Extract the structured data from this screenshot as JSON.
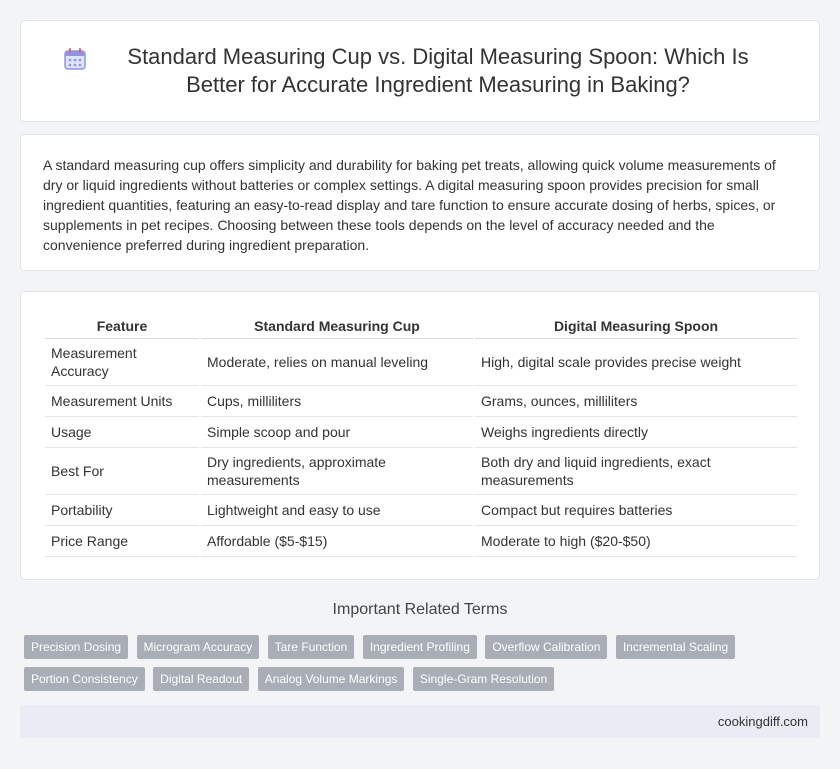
{
  "header": {
    "title": "Standard Measuring Cup vs. Digital Measuring Spoon: Which Is Better for Accurate Ingredient Measuring in Baking?",
    "icon": "calendar-icon"
  },
  "intro": {
    "text": "A standard measuring cup offers simplicity and durability for baking pet treats, allowing quick volume measurements of dry or liquid ingredients without batteries or complex settings. A digital measuring spoon provides precision for small ingredient quantities, featuring an easy-to-read display and tare function to ensure accurate dosing of herbs, spices, or supplements in pet recipes. Choosing between these tools depends on the level of accuracy needed and the convenience preferred during ingredient preparation."
  },
  "table": {
    "headers": [
      "Feature",
      "Standard Measuring Cup",
      "Digital Measuring Spoon"
    ],
    "rows": [
      [
        "Measurement Accuracy",
        "Moderate, relies on manual leveling",
        "High, digital scale provides precise weight"
      ],
      [
        "Measurement Units",
        "Cups, milliliters",
        "Grams, ounces, milliliters"
      ],
      [
        "Usage",
        "Simple scoop and pour",
        "Weighs ingredients directly"
      ],
      [
        "Best For",
        "Dry ingredients, approximate measurements",
        "Both dry and liquid ingredients, exact measurements"
      ],
      [
        "Portability",
        "Lightweight and easy to use",
        "Compact but requires batteries"
      ],
      [
        "Price Range",
        "Affordable ($5-$15)",
        "Moderate to high ($20-$50)"
      ]
    ]
  },
  "related": {
    "title": "Important Related Terms",
    "tags": [
      "Precision Dosing",
      "Microgram Accuracy",
      "Tare Function",
      "Ingredient Profiling",
      "Overflow Calibration",
      "Incremental Scaling",
      "Portion Consistency",
      "Digital Readout",
      "Analog Volume Markings",
      "Single-Gram Resolution"
    ]
  },
  "footer": {
    "site": "cookingdiff.com"
  },
  "colors": {
    "tag_bg": "#a9aeb6",
    "footer_bg": "#e9ecf5",
    "page_bg": "#f3f4f6"
  }
}
